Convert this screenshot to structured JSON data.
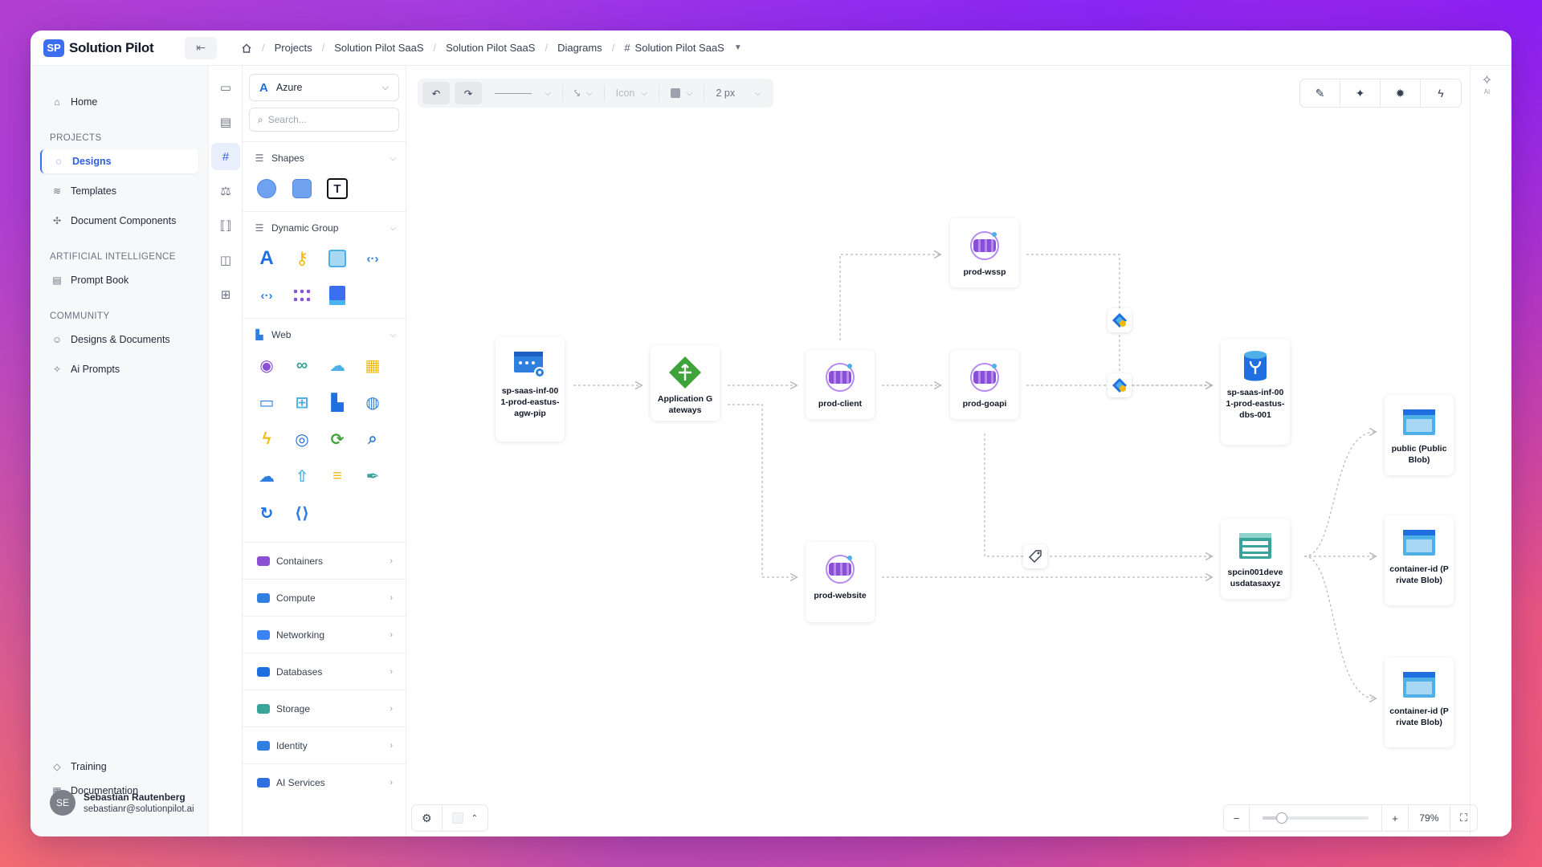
{
  "app": {
    "logo_badge": "SP",
    "logo_text": "Solution Pilot"
  },
  "breadcrumbs": [
    "Projects",
    "Solution Pilot SaaS",
    "Solution Pilot SaaS",
    "Diagrams",
    "Solution Pilot SaaS"
  ],
  "sidebar": {
    "home": "Home",
    "projects_label": "PROJECTS",
    "projects": [
      "Designs",
      "Templates",
      "Document Components"
    ],
    "ai_label": "ARTIFICIAL INTELLIGENCE",
    "ai": [
      "Prompt Book"
    ],
    "community_label": "COMMUNITY",
    "community": [
      "Designs & Documents",
      "Ai Prompts"
    ],
    "footer": [
      "Training",
      "Documentation"
    ],
    "user": {
      "initials": "SE",
      "name": "Sebastian Rautenberg",
      "email": "sebastianr@solutionpilot.ai"
    }
  },
  "palette": {
    "provider": "Azure",
    "search_placeholder": "Search...",
    "groups": {
      "shapes": "Shapes",
      "dynamic": "Dynamic Group",
      "web": "Web"
    },
    "categories": [
      "Containers",
      "Compute",
      "Networking",
      "Databases",
      "Storage",
      "Identity",
      "AI Services"
    ],
    "category_colors": [
      "#8b4fd6",
      "#2f7fe0",
      "#3b82f6",
      "#1f6fe0",
      "#3aa39a",
      "#2f7fe0",
      "#2f6fe0"
    ]
  },
  "toolbar": {
    "icon_label": "Icon",
    "stroke_width": "2 px"
  },
  "zoom": {
    "level_label": "79%",
    "level": 0.18
  },
  "ai_panel": {
    "label": "AI"
  },
  "diagram": {
    "nodes": {
      "pip": "sp-saas-inf-001-prod-eastus-agw-pip",
      "agw": "Application Gateways",
      "client": "prod-client",
      "wssp": "prod-wssp",
      "goapi": "prod-goapi",
      "website": "prod-website",
      "db": "sp-saas-inf-001-prod-eastus-dbs-001",
      "storage": "spcin001deveusdatasaxyz",
      "public": "public (Public Blob)",
      "container1": "container-id (Private Blob)",
      "container2": "container-id (Private Blob)"
    }
  },
  "colors": {
    "accent": "#3b6ff0",
    "edge": "#b3b8c0"
  }
}
